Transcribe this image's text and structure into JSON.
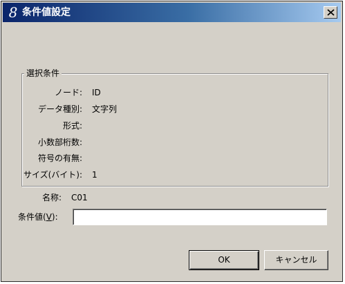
{
  "window": {
    "title": "条件値設定",
    "title_icon": "8"
  },
  "group": {
    "legend": "選択条件",
    "rows": [
      {
        "label": "ノード:",
        "value": "ID"
      },
      {
        "label": "データ種別:",
        "value": "文字列"
      },
      {
        "label": "形式:",
        "value": ""
      },
      {
        "label": "小数部桁数:",
        "value": ""
      },
      {
        "label": "符号の有無:",
        "value": ""
      },
      {
        "label": "サイズ(バイト):",
        "value": "1"
      }
    ]
  },
  "name": {
    "label": "名称:",
    "value": "C01"
  },
  "condition": {
    "label_prefix": "条件値(",
    "label_accel": "V",
    "label_suffix": "):",
    "value": ""
  },
  "buttons": {
    "ok": "OK",
    "cancel": "キャンセル"
  },
  "colors": {
    "title_start": "#0a246a",
    "title_end": "#a6caf0",
    "face": "#d4d0c8"
  }
}
